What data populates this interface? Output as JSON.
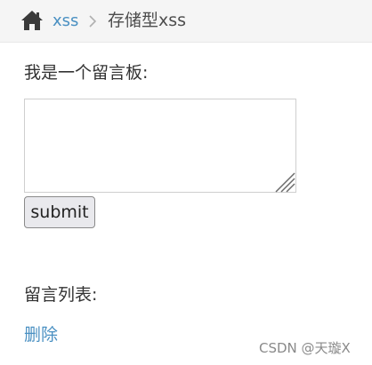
{
  "breadcrumb": {
    "home_icon": "home-icon",
    "link_label": "xss",
    "separator_icon": "chevron-right-icon",
    "current_label": "存储型xss"
  },
  "board": {
    "title": "我是一个留言板:",
    "textarea_value": "",
    "submit_label": "submit"
  },
  "messages": {
    "title": "留言列表:",
    "delete_label": "删除"
  },
  "watermark": "CSDN @天璇X",
  "colors": {
    "link": "#4a90c2",
    "breadcrumb_bg": "#f5f5f5",
    "text": "#333333"
  }
}
